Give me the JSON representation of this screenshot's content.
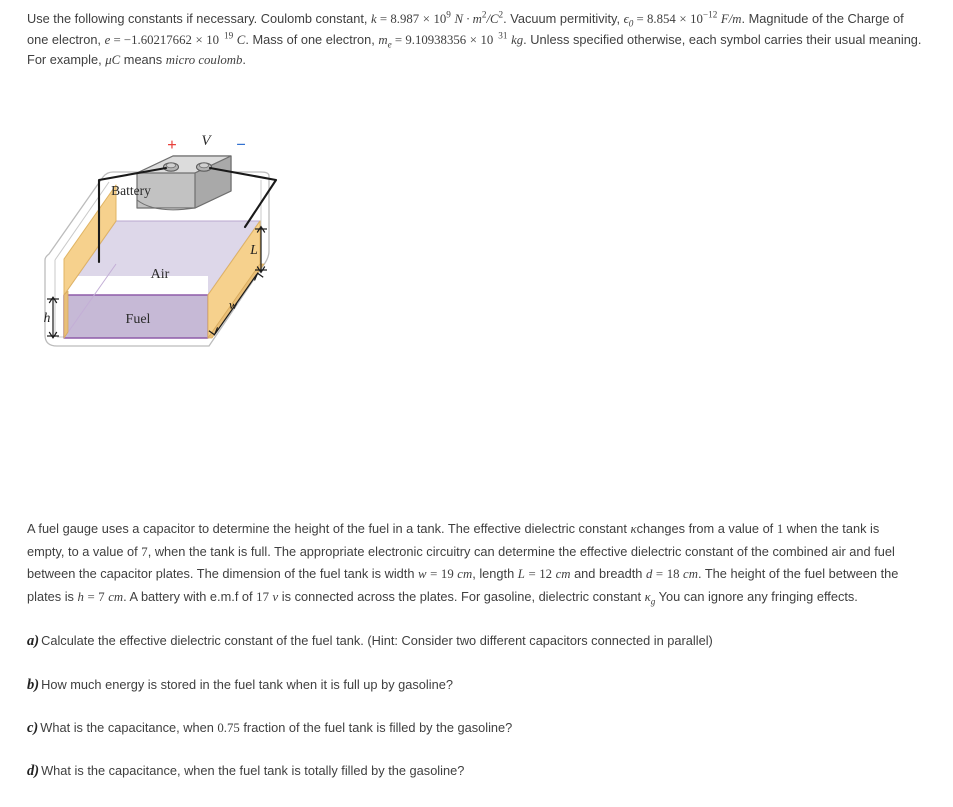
{
  "document": {
    "constants_header": {
      "lead": "Use the following constants if necessary. Coulomb constant,",
      "coulomb_symbol": "k",
      "coulomb_value": "8.987",
      "coulomb_times": "×",
      "coulomb_base": "10",
      "coulomb_exp": "9",
      "coulomb_units": "N · m",
      "coulomb_units_exp1": "2",
      "coulomb_units_slash": "/C",
      "coulomb_units_exp2": "2",
      "permittivity_lead": "Vacuum permitivity,",
      "permittivity_symbol": "ϵ",
      "permittivity_sub": "0",
      "permittivity_value": "8.854",
      "permittivity_base": "10",
      "permittivity_exp": "−12",
      "permittivity_units": "F/m",
      "charge_lead": "Magnitude of the Charge of one electron,",
      "charge_symbol": "e",
      "charge_value": "−1.60217662",
      "charge_base": "10",
      "charge_exp": "19",
      "charge_units": "C",
      "mass_lead": "Mass of one electron,",
      "mass_symbol": "m",
      "mass_sub": "e",
      "mass_value": "9.10938356",
      "mass_base": "10",
      "mass_exp": "31",
      "mass_units": "kg",
      "tail_1": "Unless specified otherwise, each symbol carries their usual meaning. For example,",
      "micro_symbol": "μC",
      "tail_2": "means",
      "micro_words": "micro coulomb",
      "tail_3": "."
    },
    "figure": {
      "caption_battery": "Battery",
      "caption_air": "Air",
      "caption_fuel": "Fuel",
      "label_voltage": "V",
      "label_plus": "+",
      "label_minus": "−",
      "label_length": "L",
      "label_width": "w",
      "label_height": "h",
      "colors": {
        "plate": "#f6d18d",
        "plate_edge": "#e0b463",
        "air_region": "#ddd7e9",
        "fuel_region": "#c6b9d6",
        "fuel_outline": "#8e5ca8",
        "air_outline": "#b9a7cf",
        "tank_outline": "#b9b9b9",
        "battery_body": "#c2c2c2",
        "battery_top": "#d9d9d9",
        "battery_side": "#a8a8a8",
        "wire": "#1a1a1a",
        "plus_sign": "#e8413c",
        "minus_sign": "#2f6fd0"
      }
    },
    "problem_statement": {
      "s1": "A fuel gauge uses a capacitor to determine the height of the fuel in a tank. The effective dielectric constant",
      "kappa": "κ",
      "s2": "changes from a value of",
      "val_empty": "1",
      "s3": "when the tank is empty, to a value of",
      "val_full": "7",
      "s4": ", when the tank is full. The appropriate electronic circuitry can determine the effective dielectric constant of the combined air and fuel between the capacitor plates. The dimension of the fuel tank is width",
      "w_symbol": "w",
      "w_eq": "=",
      "w_value": "19",
      "w_unit": "cm",
      "s5": ", length",
      "L_symbol": "L",
      "L_eq": "=",
      "L_value": "12",
      "L_unit": "cm",
      "s6": "and breadth",
      "d_symbol": "d",
      "d_eq": "=",
      "d_value": "18",
      "d_unit": "cm",
      "s7": ". The height of the fuel between the plates is",
      "h_symbol": "h",
      "h_eq": "=",
      "h_value": "7",
      "h_unit": "cm",
      "s8": ". A battery with e.m.f of",
      "emf_value": "17",
      "emf_unit": "v",
      "s9": "is connected across the plates. For gasoline, dielectric constant",
      "kappa_g": "κ",
      "kappa_g_sub": "g",
      "s10": "You can ignore any fringing effects."
    },
    "questions": [
      {
        "label": "a)",
        "text": "Calculate the effective dielectric constant of the fuel tank. (Hint: Consider two different capacitors connected in parallel)"
      },
      {
        "label": "b)",
        "text": "How much energy is stored in the fuel tank when it is full up by gasoline?"
      },
      {
        "label": "c)",
        "text_pre": "What is the capacitance, when",
        "value": "0.75",
        "text_post": "fraction of the fuel tank is filled by the gasoline?"
      },
      {
        "label": "d)",
        "text": "What is the capacitance, when the fuel tank is totally filled by the gasoline?"
      }
    ]
  }
}
